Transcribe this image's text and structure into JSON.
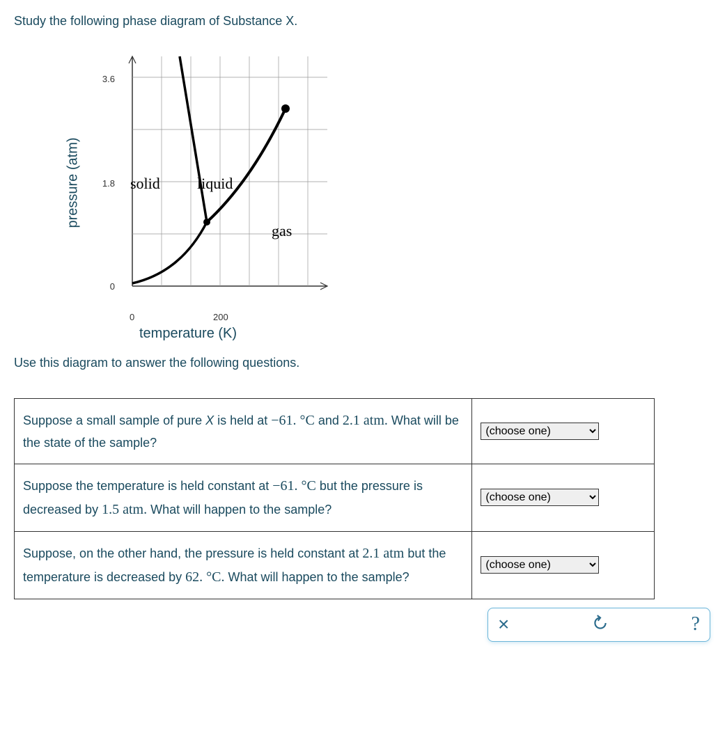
{
  "intro": "Study the following phase diagram of Substance X.",
  "follow_up": "Use this diagram to answer the following questions.",
  "chart_data": {
    "type": "line",
    "title": "",
    "xlabel": "temperature (K)",
    "ylabel": "pressure (atm)",
    "xlim": [
      0,
      400
    ],
    "ylim": [
      0,
      4.0
    ],
    "xticks": [
      0,
      200
    ],
    "yticks": [
      0,
      1.8,
      3.6
    ],
    "regions": {
      "solid": {
        "label": "solid",
        "pos_x": 107,
        "pos_y": 200
      },
      "liquid": {
        "label": "liquid",
        "pos_x": 203,
        "pos_y": 200
      },
      "gas": {
        "label": "gas",
        "pos_x": 310,
        "pos_y": 268
      }
    },
    "triple_point": {
      "x": 170,
      "y": 1.1
    },
    "critical_point": {
      "x": 320,
      "y": 3.15
    },
    "series": [
      {
        "name": "solid-liquid",
        "from": [
          170,
          1.1
        ],
        "to": [
          115,
          4.0
        ]
      },
      {
        "name": "solid-gas",
        "from": [
          0,
          0.05
        ],
        "to": [
          170,
          1.1
        ]
      },
      {
        "name": "liquid-gas",
        "from": [
          170,
          1.1
        ],
        "to": [
          320,
          3.15
        ]
      }
    ]
  },
  "questions": {
    "q1": {
      "prefix": "Suppose a small sample of pure ",
      "var": "X",
      "mid1": " is held at ",
      "val1": "−61. °C",
      "mid2": " and ",
      "val2": "2.1 atm.",
      "suffix": " What will be the state of the sample?"
    },
    "q2": {
      "prefix": "Suppose the temperature is held constant at ",
      "val1": "−61. °C",
      "mid": " but the pressure is decreased by ",
      "val2": "1.5 atm.",
      "suffix": " What will happen to the sample?"
    },
    "q3": {
      "prefix": "Suppose, on the other hand, the pressure is held constant at ",
      "val1": "2.1 atm",
      "mid": " but the temperature is decreased by ",
      "val2": "62. °C.",
      "suffix": " What will happen to the sample?"
    }
  },
  "dropdown": {
    "placeholder": "(choose one)"
  },
  "buttons": {
    "clear": "×",
    "reset": "↺",
    "help": "?"
  }
}
